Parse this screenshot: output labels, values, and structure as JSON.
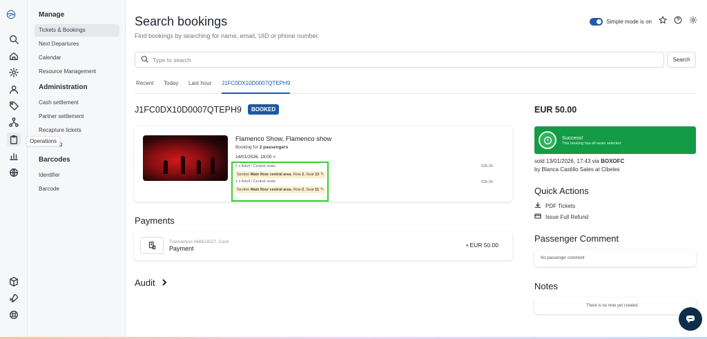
{
  "rail": {
    "tooltip": "Operations",
    "icons": [
      "logo-icon",
      "search-icon",
      "home-icon",
      "settings-icon",
      "user-icon",
      "tag-icon",
      "network-icon",
      "clipboard-icon",
      "chart-icon",
      "globe-icon",
      "box-icon",
      "rocket-icon",
      "help-ring-icon"
    ]
  },
  "nav": {
    "manage": "Manage",
    "manage_items": [
      "Tickets & Bookings",
      "Next Departures",
      "Calendar",
      "Resource Management"
    ],
    "administration": "Administration",
    "admin_items": [
      "Cash settlement",
      "Partner settlement",
      "Recapture tickets",
      "Tracking"
    ],
    "barcodes": "Barcodes",
    "barcode_items": [
      "Identifier",
      "Barcode"
    ]
  },
  "header": {
    "title": "Search bookings",
    "subtitle": "Find bookings by searching for name, email, UID or phone number.",
    "simple_mode": "Simple mode is on"
  },
  "search": {
    "placeholder": "Type to search",
    "button": "Search"
  },
  "tabs": [
    "Recent",
    "Today",
    "Last hour",
    "J1FC0DX10D0007QTEPH9"
  ],
  "booking": {
    "id": "J1FC0DX10D0007QTEPH9",
    "status": "BOOKED",
    "event_name": "Flamenco Show, Flamenco show",
    "passengers_prefix": "Booking for ",
    "passengers": "2 passengers",
    "date": "14/01/2026, 19:00 >",
    "tickets": [
      {
        "category": "1 x Adult / Central seats",
        "section_prefix": "Section ",
        "section": "Main floor central area",
        "row_prefix": ", Row ",
        "row": "2",
        "seat_prefix": ", Seat ",
        "seat": "13",
        "price": "€25.00"
      },
      {
        "category": "1 x Adult / Central seats",
        "section_prefix": "Section ",
        "section": "Main floor central area",
        "row_prefix": ", Row ",
        "row": "2",
        "seat_prefix": ", Seat ",
        "seat": "11",
        "price": "€25.00"
      }
    ]
  },
  "payments": {
    "title": "Payments",
    "transaction": "Transaction #68423527, Cash",
    "label": "Payment",
    "amount": "• EUR 50.00"
  },
  "audit": {
    "title": "Audit"
  },
  "summary": {
    "total": "EUR 50.00",
    "success_title": "Success!",
    "success_sub": "This booking has all seats selected",
    "sold_prefix": "sold 13/01/2026, 17:43 via ",
    "sold_channel": "BOXOFC",
    "sold_by": "by Blanca Castillo Sales at Cibeles"
  },
  "quick_actions": {
    "title": "Quick Actions",
    "pdf": "PDF Tickets",
    "refund": "Issue Full Refund"
  },
  "passenger_comment": {
    "title": "Passenger Comment",
    "empty": "No passenger comment"
  },
  "notes": {
    "title": "Notes",
    "empty": "There is no note yet created"
  },
  "colors": {
    "accent": "#1e5aa8",
    "badge": "#1d5a9e",
    "success": "#149b46",
    "highlight": "#35d12b",
    "chat": "#0e2d4a"
  }
}
